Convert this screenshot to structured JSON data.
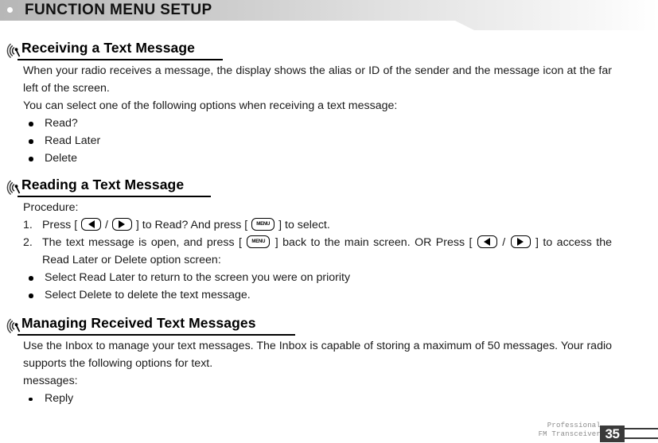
{
  "header": {
    "title": "FUNCTION MENU SETUP",
    "bullet_icon": "circle-dot-icon"
  },
  "sections": [
    {
      "icon": "signal-waves-icon",
      "title": "Receiving a Text Message",
      "paragraphs": [
        "When your radio receives a message, the display shows the alias or ID of the sender and the message icon at the far left of the screen.",
        "You can select one of the following options when receiving a text message:"
      ],
      "bullets": [
        "Read?",
        "Read Later",
        "Delete"
      ]
    },
    {
      "icon": "signal-waves-icon",
      "title": "Reading a Text Message",
      "lead": "Procedure:",
      "steps": [
        {
          "number": "1.",
          "parts": [
            {
              "t": "text",
              "v": "Press [ "
            },
            {
              "t": "key",
              "v": "arrow-left-key"
            },
            {
              "t": "text",
              "v": " / "
            },
            {
              "t": "key",
              "v": "arrow-right-key"
            },
            {
              "t": "text",
              "v": " ] to Read? And press [ "
            },
            {
              "t": "key",
              "v": "menu-key"
            },
            {
              "t": "text",
              "v": " ] to select."
            }
          ]
        },
        {
          "number": "2.",
          "parts": [
            {
              "t": "text",
              "v": "The text message is open, and press [ "
            },
            {
              "t": "key",
              "v": "menu-key"
            },
            {
              "t": "text",
              "v": " ] back to the main screen. OR Press [ "
            },
            {
              "t": "key",
              "v": "arrow-left-key"
            },
            {
              "t": "text",
              "v": " / "
            },
            {
              "t": "key",
              "v": "arrow-right-key"
            },
            {
              "t": "text",
              "v": " ] to access the Read Later or Delete option screen:"
            }
          ]
        }
      ],
      "bullets": [
        "Select Read Later to return to the screen you were on priority",
        "Select Delete to delete the text message."
      ]
    },
    {
      "icon": "signal-waves-icon",
      "title": "Managing Received Text Messages",
      "paragraphs": [
        "Use the Inbox to manage your text messages. The Inbox is capable of storing a maximum of 50 messages. Your  radio  supports  the  following  options  for  text.",
        "messages:"
      ],
      "bullets": [
        "Reply"
      ]
    }
  ],
  "key_labels": {
    "menu": "MENU"
  },
  "footer": {
    "brand_line1": "Professional",
    "brand_line2": "FM Transceiver",
    "page_number": "35"
  }
}
